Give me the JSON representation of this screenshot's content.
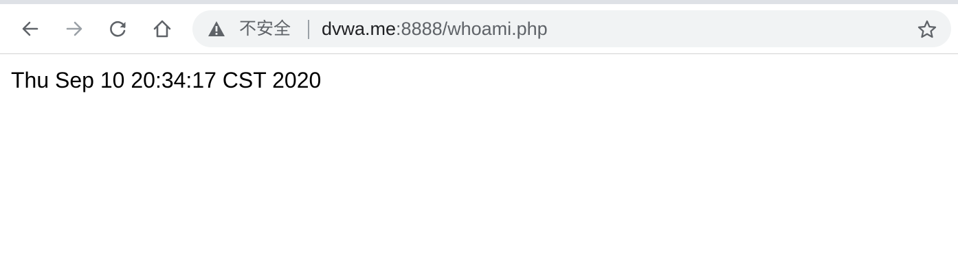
{
  "browser": {
    "colors": {
      "toolbar_bg": "#ffffff",
      "omnibox_bg": "#f1f3f4",
      "icon_active": "#5f6368",
      "icon_disabled": "#9aa0a6"
    },
    "nav": {
      "back_icon": "arrow-left-icon",
      "forward_icon": "arrow-right-icon",
      "forward_disabled": true,
      "reload_icon": "reload-icon",
      "home_icon": "home-icon"
    },
    "omnibox": {
      "security_icon": "warning-triangle-icon",
      "security_label": "不安全",
      "url_host": "dvwa.me",
      "url_rest": ":8888/whoami.php",
      "bookmark_icon": "star-outline-icon"
    }
  },
  "page": {
    "text": "Thu Sep 10 20:34:17 CST 2020"
  }
}
